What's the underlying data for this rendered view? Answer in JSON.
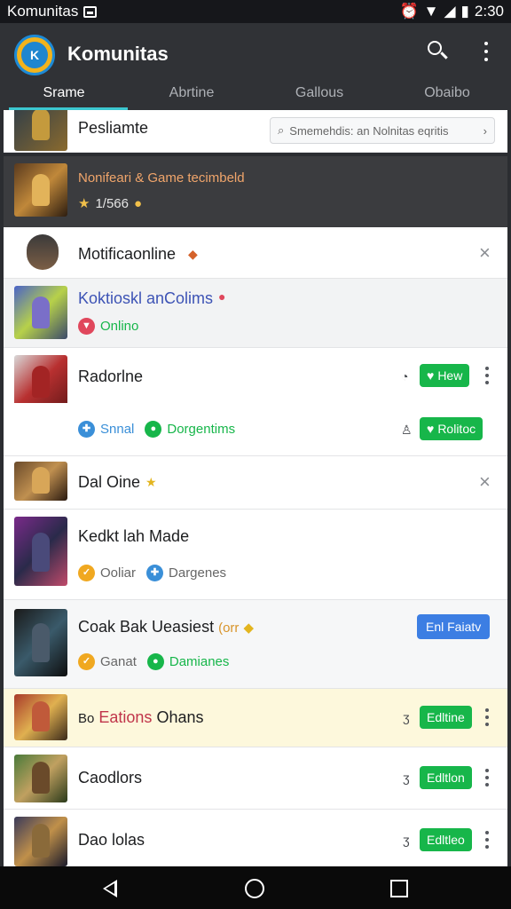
{
  "status_bar": {
    "app_name": "Komunitas",
    "time": "2:30"
  },
  "app_bar": {
    "logo_text": "K",
    "title": "Komunitas"
  },
  "tabs": [
    {
      "label": "Srame",
      "active": true
    },
    {
      "label": "Abrtine",
      "active": false
    },
    {
      "label": "Gallous",
      "active": false
    },
    {
      "label": "Obaibo",
      "active": false
    }
  ],
  "rows": {
    "r0": {
      "title": "Pesliamte",
      "search_placeholder": "Smemehdis: an Nolnitas eqritis"
    },
    "r1": {
      "title": "Nonifeari & Game tecimbeld",
      "count": "1/566"
    },
    "r2": {
      "title": "Motificaonline"
    },
    "r3": {
      "title": "Koktioskl anColims",
      "status": "Onlino"
    },
    "r4": {
      "title": "Radorlne",
      "btn": "Hew"
    },
    "r5": {
      "sub1": "Snnal",
      "sub2": "Dorgentims",
      "btn": "Rolitoc"
    },
    "r6": {
      "title": "Dal Oine"
    },
    "r7": {
      "title": "Kedkt lah Made",
      "sub1": "Ooliar",
      "sub2": "Dargenes"
    },
    "r8": {
      "title": "Coak Bak Ueasiest",
      "title_suffix": "(orr",
      "btn": "Enl Faiatv",
      "sub1": "Ganat",
      "sub2": "Damianes"
    },
    "r9": {
      "title_prefix": "Bo",
      "title_red": "Eations",
      "title_end": "Ohans",
      "btn": "Edltine"
    },
    "r10": {
      "title": "Caodlors",
      "btn": "Edltlon"
    },
    "r11": {
      "title": "Dao lolas",
      "btn": "Edltleo"
    }
  },
  "colors": {
    "accent_tab": "#3bc7d0",
    "green": "#17b64a",
    "blue": "#3c7ee3",
    "highlight": "#fdf8dc"
  },
  "icons": [
    "search-icon",
    "more-vert-icon",
    "close-icon",
    "person-icon",
    "back-icon",
    "home-icon",
    "recents-icon"
  ]
}
